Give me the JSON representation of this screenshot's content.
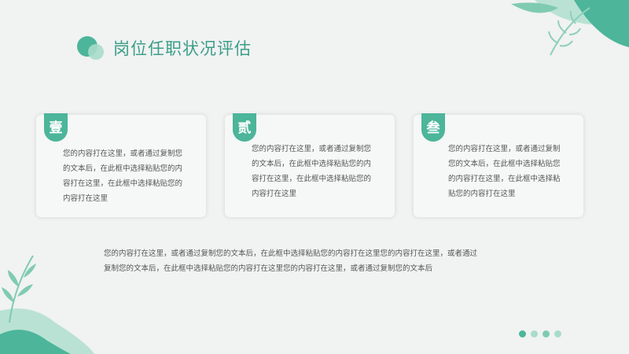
{
  "title": "岗位任职状况评估",
  "cards": [
    {
      "badge": "壹",
      "text": "您的内容打在这里，或者通过复制您的文本后，在此框中选择粘贴您的内容打在这里，在此框中选择粘贴您的内容打在这里"
    },
    {
      "badge": "贰",
      "text": "您的内容打在这里，或者通过复制您的文本后，在此框中选择粘贴您的内容打在这里，在此框中选择粘贴您的内容打在这里"
    },
    {
      "badge": "叁",
      "text": "您的内容打在这里，或者通过复制您的文本后，在此框中选择粘贴您的内容打在这里，在此框中选择粘贴您的内容打在这里"
    }
  ],
  "body_text": "您的内容打在这里，或者通过复制您的文本后，在此框中选择粘贴您的内容打在这里您的内容打在这里，或者通过复制您的文本后，在此框中选择粘贴您的内容打在这里您的内容打在这里，或者通过复制您的文本后",
  "colors": {
    "accent": "#4cb59a",
    "light_accent": "#a8dccb",
    "background": "#f1f2f2"
  },
  "pager": {
    "count": 4,
    "active": 0
  }
}
